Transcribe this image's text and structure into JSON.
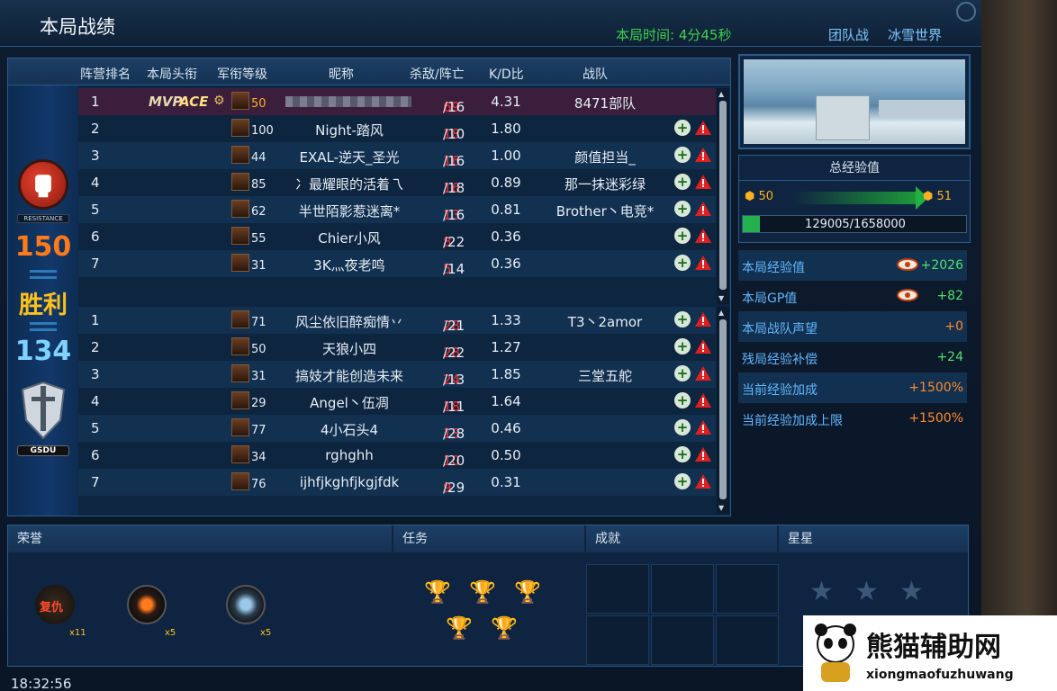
{
  "header": {
    "title": "本局战绩",
    "match_time": "本局时间: 4分45秒",
    "mode": "团队战",
    "map": "冰雪世界"
  },
  "columns": [
    "阵营排名",
    "本局头衔",
    "军衔等级",
    "昵称",
    "杀敌/阵亡",
    "K/D比",
    "战队"
  ],
  "left_panel": {
    "team1_label": "RESISTANCE",
    "team1_score": "150",
    "result": "胜利",
    "team2_score": "134",
    "team2_label": "GSDU"
  },
  "team1": [
    {
      "rank": "1",
      "level": "50",
      "name": "",
      "kills": "69",
      "deaths": "/16",
      "kd": "4.31",
      "clan": "8471部队",
      "titles": [
        "MVP",
        "ACE",
        "WHEEL"
      ],
      "is_self": true
    },
    {
      "rank": "2",
      "level": "100",
      "name": "Night-踏风",
      "kills": "18",
      "deaths": "/10",
      "kd": "1.80",
      "clan": ""
    },
    {
      "rank": "3",
      "level": "44",
      "name": "EXAL-逆天_圣光",
      "kills": "16",
      "deaths": "/16",
      "kd": "1.00",
      "clan": "颜值担当_"
    },
    {
      "rank": "4",
      "level": "85",
      "name": "冫最耀眼的活着乁",
      "kills": "16",
      "deaths": "/18",
      "kd": "0.89",
      "clan": "那一抹迷彩绿"
    },
    {
      "rank": "5",
      "level": "62",
      "name": "半世陌影惹迷离*",
      "kills": "13",
      "deaths": "/16",
      "kd": "0.81",
      "clan": "Brother丶电竞*"
    },
    {
      "rank": "6",
      "level": "55",
      "name": "Chier小风",
      "kills": "8",
      "deaths": "/22",
      "kd": "0.36",
      "clan": ""
    },
    {
      "rank": "7",
      "level": "31",
      "name": "3K灬夜老鸣",
      "kills": "5",
      "deaths": "/14",
      "kd": "0.36",
      "clan": ""
    }
  ],
  "team2": [
    {
      "rank": "1",
      "level": "71",
      "name": "风尘依旧醉痴情丷",
      "kills": "28",
      "deaths": "/21",
      "kd": "1.33",
      "clan": "T3丶2amor"
    },
    {
      "rank": "2",
      "level": "50",
      "name": "天狼小四",
      "kills": "28",
      "deaths": "/22",
      "kd": "1.27",
      "clan": ""
    },
    {
      "rank": "3",
      "level": "31",
      "name": "搞妓才能创造未来",
      "kills": "24",
      "deaths": "/13",
      "kd": "1.85",
      "clan": "三堂五舵"
    },
    {
      "rank": "4",
      "level": "29",
      "name": "Angel丶伍凋",
      "kills": "18",
      "deaths": "/11",
      "kd": "1.64",
      "clan": ""
    },
    {
      "rank": "5",
      "level": "77",
      "name": "4小石头4",
      "kills": "13",
      "deaths": "/28",
      "kd": "0.46",
      "clan": ""
    },
    {
      "rank": "6",
      "level": "34",
      "name": "rghghh",
      "kills": "10",
      "deaths": "/20",
      "kd": "0.50",
      "clan": ""
    },
    {
      "rank": "7",
      "level": "76",
      "name": "ijhfjkghfjkgjfdk",
      "kills": "9",
      "deaths": "/29",
      "kd": "0.31",
      "clan": ""
    }
  ],
  "exp": {
    "title": "总经验值",
    "from_level": "50",
    "to_level": "51",
    "progress_text": "129005/1658000",
    "progress": 0.078
  },
  "stats": [
    {
      "label": "本局经验值",
      "value": "+2026",
      "color": "green",
      "icon": "gp-icon"
    },
    {
      "label": "本局GP值",
      "value": "+82",
      "color": "green",
      "icon": "gp-icon"
    },
    {
      "label": "本局战队声望",
      "value": "+0",
      "color": "orange"
    },
    {
      "label": "残局经验补偿",
      "value": "+24",
      "color": "green"
    },
    {
      "label": "当前经验加成",
      "value": "+1500%",
      "color": "orange"
    },
    {
      "label": "当前经验加成上限",
      "value": "+1500%",
      "color": "orange"
    }
  ],
  "bottom": {
    "honor_title": "荣誉",
    "tasks_title": "任务",
    "achievements_title": "成就",
    "stars_title": "星星",
    "medals": [
      {
        "name": "revenge-medal",
        "text": "复仇",
        "count": "x11"
      },
      {
        "name": "explosive-medal",
        "count": "x5"
      },
      {
        "name": "gear-medal",
        "count": "x5"
      }
    ]
  },
  "clock": "18:32:56",
  "watermark": {
    "title": "熊猫辅助网",
    "url": "xiongmaofuzhuwang"
  },
  "colors": {
    "kills_red": "#ff3030",
    "green": "#4fe06a",
    "orange": "#ff8a2a",
    "accent_blue": "#63b8ff"
  }
}
